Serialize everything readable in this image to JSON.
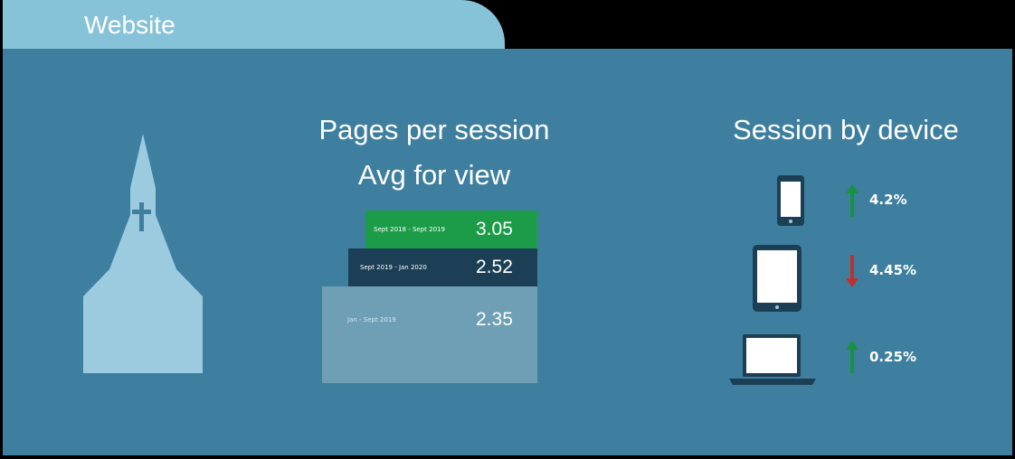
{
  "tab": {
    "title": "Website"
  },
  "pages_per_session": {
    "title_line1": "Pages per session",
    "title_line2": "Avg for view",
    "bars": [
      {
        "label": "Sept 2018 - Sept 2019",
        "value": "3.05",
        "color": "#1c9c48"
      },
      {
        "label": "Sept 2019 - Jan 2020",
        "value": "2.52",
        "color": "#1d3f55"
      },
      {
        "label": "Jan - Sept 2019",
        "value": "2.35",
        "color": "#6e9fb5"
      }
    ]
  },
  "session_by_device": {
    "title": "Session by device",
    "items": [
      {
        "device": "phone-icon",
        "trend": "up",
        "value": "4.2%"
      },
      {
        "device": "tablet-icon",
        "trend": "down",
        "value": "4.45%"
      },
      {
        "device": "laptop-icon",
        "trend": "up",
        "value": "0.25%"
      }
    ]
  },
  "colors": {
    "panel": "#3e7fa0",
    "tab": "#87c3d8",
    "up_arrow": "#17923f",
    "down_arrow": "#c0312b"
  }
}
